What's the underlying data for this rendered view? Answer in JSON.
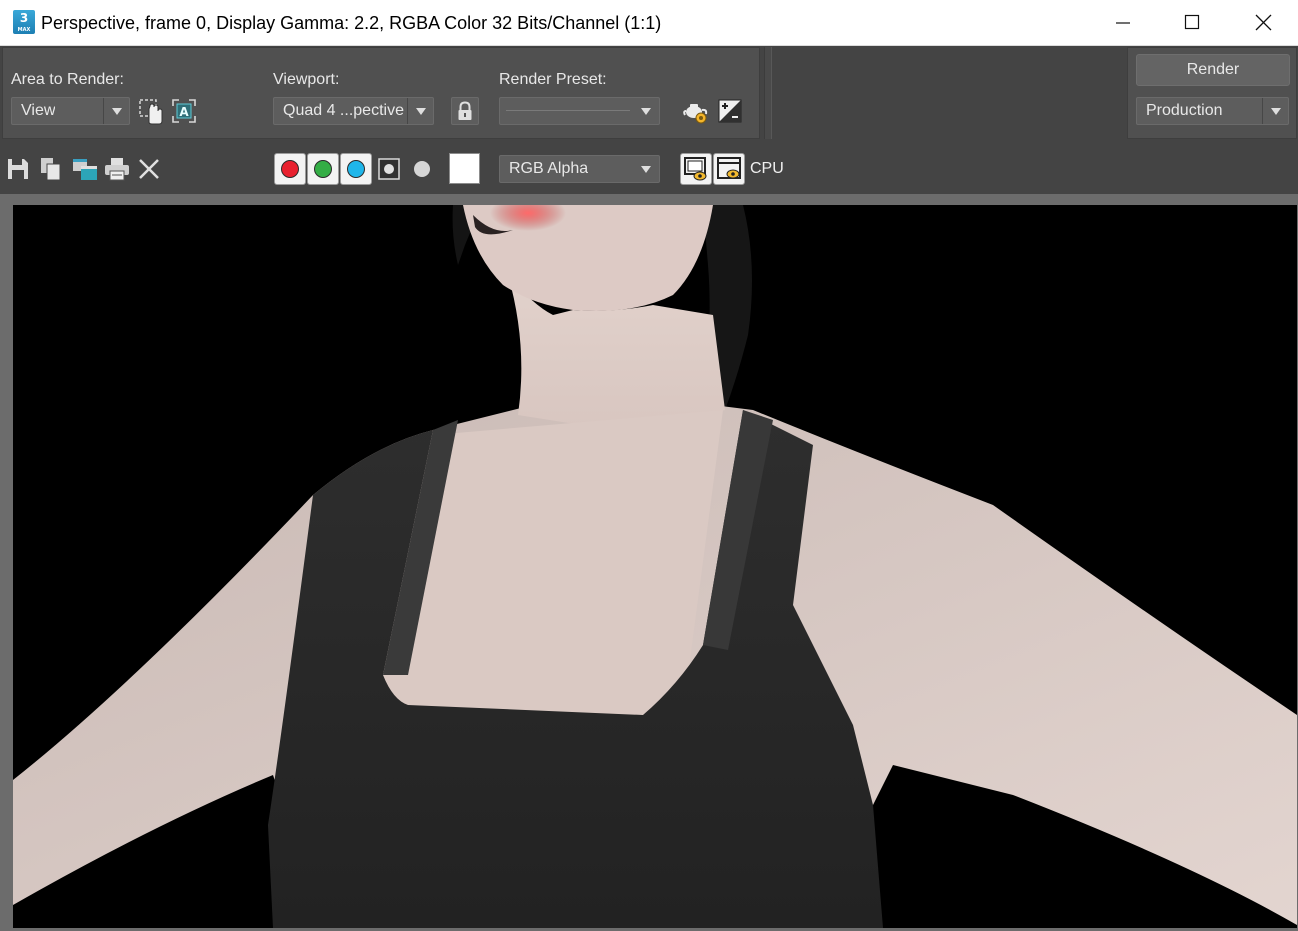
{
  "window": {
    "title": "Perspective, frame 0, Display Gamma: 2.2, RGBA Color 32 Bits/Channel (1:1)",
    "app_icon_number": "3",
    "app_icon_caption": "MAX"
  },
  "area_to_render": {
    "label": "Area to Render:",
    "value": "View"
  },
  "viewport": {
    "label": "Viewport:",
    "value": "Quad 4 ...pective"
  },
  "render_preset": {
    "label": "Render Preset:",
    "value": ""
  },
  "render_button": {
    "label": "Render"
  },
  "production_dropdown": {
    "value": "Production"
  },
  "channel_display": {
    "value": "RGB Alpha"
  },
  "renderer": {
    "label": "CPU"
  },
  "colors": {
    "red_channel": "#e8212f",
    "green_channel": "#33ad45",
    "blue_channel": "#1fb6ea",
    "panel_bg": "#505050",
    "render_bg": "#000000"
  },
  "icons": [
    "save-icon",
    "copy-icon",
    "clone-window-icon",
    "print-icon",
    "clear-icon",
    "edit-region-icon",
    "auto-region-icon",
    "lock-icon",
    "environment-icon",
    "exposure-icon",
    "display-alpha-icon",
    "monochrome-icon",
    "color-swatch-icon",
    "toggle-ui-overlay-icon",
    "toggle-ui-icon"
  ]
}
